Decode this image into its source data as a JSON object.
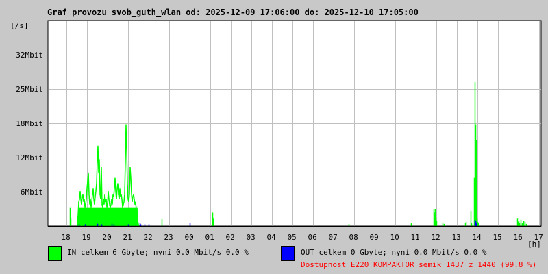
{
  "title": "Graf provozu svob_guth_wlan od: 2025-12-09 17:06:00 do: 2025-12-10 17:05:00",
  "colors": {
    "in": "#00ff00",
    "out": "#0000ff",
    "availability": "#ff0000",
    "grid": "#c0c0c0"
  },
  "legend": {
    "in": "IN celkem 6 Gbyte; nyní   0.0 Mbit/s 0.0 %",
    "out": "OUT celkem 0 Gbyte; nyní   0.0 Mbit/s 0.0 %",
    "availability": "Dostupnost E220 KOMPAKTOR semik 1437 z 1440 (99.8 %)"
  },
  "chart_data": {
    "type": "line",
    "title": "Graf provozu svob_guth_wlan od: 2025-12-09 17:06:00 do: 2025-12-10 17:05:00",
    "xlabel": "[h]",
    "ylabel": "[/s]",
    "x_unit": "hours since 2025-12-09 17:06",
    "xlim": [
      0,
      24
    ],
    "ylim": [
      0,
      38.4
    ],
    "x_ticks": [
      {
        "label": "18",
        "at": 0.9
      },
      {
        "label": "19",
        "at": 1.9
      },
      {
        "label": "20",
        "at": 2.9
      },
      {
        "label": "21",
        "at": 3.9
      },
      {
        "label": "22",
        "at": 4.9
      },
      {
        "label": "23",
        "at": 5.9
      },
      {
        "label": "00",
        "at": 6.9
      },
      {
        "label": "01",
        "at": 7.9
      },
      {
        "label": "02",
        "at": 8.9
      },
      {
        "label": "03",
        "at": 9.9
      },
      {
        "label": "04",
        "at": 10.9
      },
      {
        "label": "05",
        "at": 11.9
      },
      {
        "label": "06",
        "at": 12.9
      },
      {
        "label": "07",
        "at": 13.9
      },
      {
        "label": "08",
        "at": 14.9
      },
      {
        "label": "09",
        "at": 15.9
      },
      {
        "label": "10",
        "at": 16.9
      },
      {
        "label": "11",
        "at": 17.9
      },
      {
        "label": "12",
        "at": 18.9
      },
      {
        "label": "13",
        "at": 19.9
      },
      {
        "label": "14",
        "at": 20.9
      },
      {
        "label": "15",
        "at": 21.9
      },
      {
        "label": "16",
        "at": 22.9
      },
      {
        "label": "17",
        "at": 23.9
      }
    ],
    "y_ticks": [
      {
        "label": "6Mbit",
        "at": 6.4
      },
      {
        "label": "12Mbit",
        "at": 12.8
      },
      {
        "label": "18Mbit",
        "at": 19.2
      },
      {
        "label": "25Mbit",
        "at": 25.6
      },
      {
        "label": "32Mbit",
        "at": 32
      }
    ],
    "grid": true,
    "series": [
      {
        "name": "IN",
        "unit": "Mbit/s",
        "segment": {
          "start": 1.4333,
          "step": 0.03333,
          "values": [
            0.5,
            2,
            4.5,
            5,
            6.5,
            5,
            4,
            5.5,
            6,
            4.5,
            5,
            3.5,
            4,
            5,
            7,
            8.5,
            10,
            6,
            4,
            5,
            3.5,
            4.5,
            6,
            7,
            5,
            4,
            5.5,
            6.5,
            8,
            12,
            15,
            10,
            12.5,
            6,
            5,
            11,
            4,
            3.5,
            5,
            4,
            6,
            4.5,
            5,
            3.5,
            4,
            6.5,
            5,
            4,
            3.5,
            4,
            5,
            4,
            6,
            5.5,
            7,
            9,
            6.5,
            5,
            7,
            8,
            6,
            5,
            7,
            5.5,
            6,
            5,
            3.5,
            4,
            4.5,
            6,
            12,
            19,
            14,
            8,
            5,
            4.5,
            6,
            11,
            9,
            6,
            4.5,
            5.5,
            6,
            5,
            4,
            4.5,
            3,
            3.5,
            1,
            0.3,
            0
          ]
        },
        "points": [
          [
            1.067,
            3.5
          ],
          [
            1.1,
            1.5
          ],
          [
            5.533,
            1.3
          ],
          [
            8.0,
            2.5
          ],
          [
            8.033,
            1.5
          ],
          [
            14.633,
            0.4
          ],
          [
            17.667,
            0.5
          ],
          [
            18.767,
            3.2
          ],
          [
            18.8,
            2.5
          ],
          [
            18.833,
            3.2
          ],
          [
            18.867,
            1.5
          ],
          [
            18.9,
            1
          ],
          [
            19.2,
            0.6
          ],
          [
            19.267,
            0.4
          ],
          [
            20.3,
            0.5
          ],
          [
            20.333,
            0.8
          ],
          [
            20.567,
            2.8
          ],
          [
            20.6,
            0.5
          ],
          [
            20.733,
            9
          ],
          [
            20.767,
            27
          ],
          [
            20.8,
            19
          ],
          [
            20.833,
            16
          ],
          [
            20.867,
            1.5
          ],
          [
            20.9,
            0.8
          ],
          [
            20.933,
            0.5
          ],
          [
            22.833,
            1.5
          ],
          [
            22.867,
            0.8
          ],
          [
            22.9,
            1
          ],
          [
            22.933,
            0.6
          ],
          [
            23.0,
            1.2
          ],
          [
            23.067,
            0.5
          ],
          [
            23.133,
            1
          ],
          [
            23.2,
            0.8
          ],
          [
            23.267,
            0.4
          ]
        ]
      },
      {
        "name": "OUT",
        "unit": "Mbit/s",
        "points": [
          [
            1.5,
            0.2
          ],
          [
            1.8,
            0.2
          ],
          [
            2.4,
            0.3
          ],
          [
            2.6,
            0.2
          ],
          [
            3.1,
            0.3
          ],
          [
            3.2,
            0.2
          ],
          [
            3.9,
            0.2
          ],
          [
            4.47,
            0.5
          ],
          [
            4.5,
            0.2
          ],
          [
            4.7,
            0.2
          ],
          [
            4.9,
            0.2
          ],
          [
            6.9,
            0.5
          ],
          [
            20.767,
            1
          ],
          [
            20.8,
            0.8
          ],
          [
            20.833,
            0.5
          ]
        ]
      }
    ]
  }
}
